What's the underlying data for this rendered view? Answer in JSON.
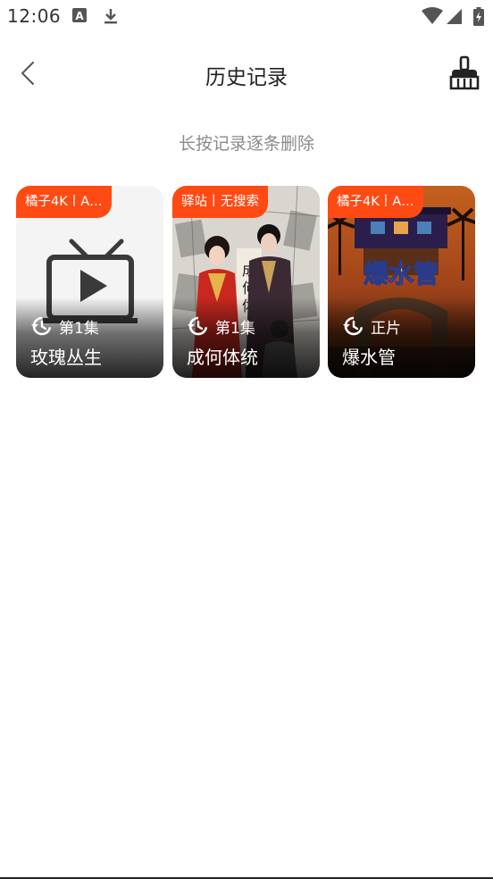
{
  "status_bar": {
    "time": "12:06",
    "left_icons": [
      "translate-app-icon",
      "download-icon"
    ],
    "right_icons": [
      "wifi-icon",
      "signal-icon",
      "battery-charging-icon"
    ]
  },
  "header": {
    "title": "历史记录",
    "back_icon": "chevron-left-icon",
    "clean_icon": "broom-icon"
  },
  "hint": "长按记录逐条删除",
  "colors": {
    "accent": "#ff4a14",
    "hint_text": "#8a8a8a",
    "title_text": "#222222"
  },
  "history": [
    {
      "badge": "橘子4K丨A…",
      "episode": "第1集",
      "title": "玫瑰丛生",
      "poster": "tv-placeholder"
    },
    {
      "badge": "驿站丨无搜索",
      "episode": "第1集",
      "title": "成何体统",
      "poster": "costume-drama-poster"
    },
    {
      "badge": "橘子4K丨A…",
      "episode": "正片",
      "title": "爆水管",
      "poster": "movie-poster"
    }
  ]
}
